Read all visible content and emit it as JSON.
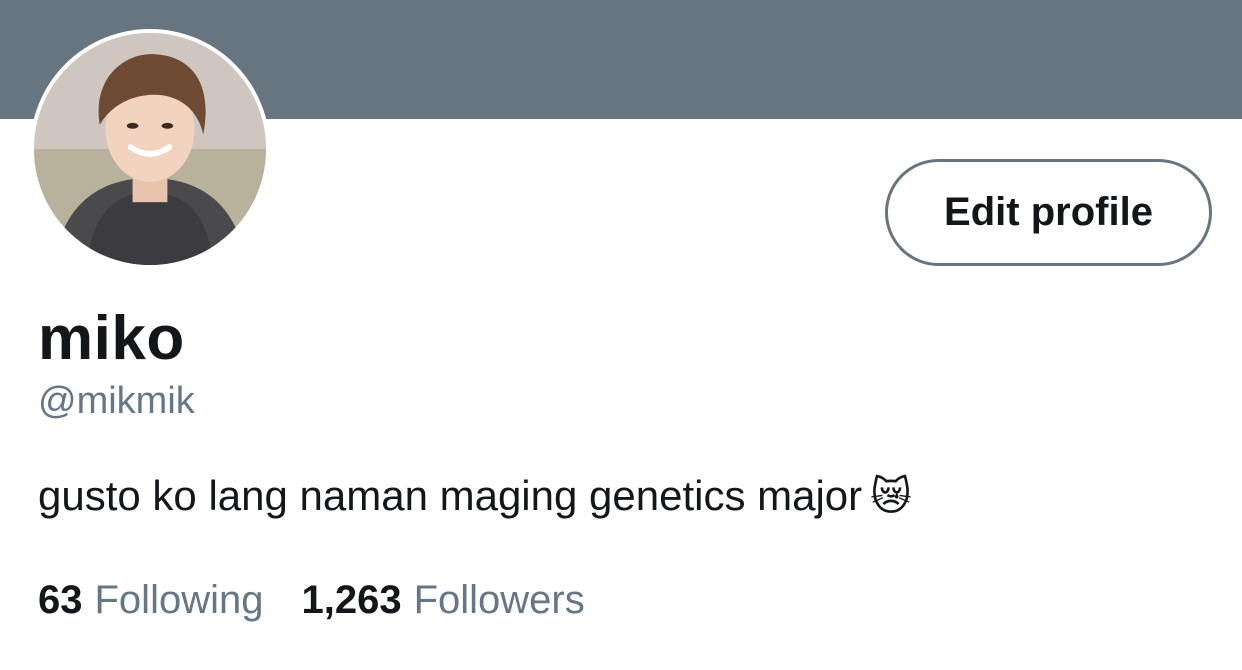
{
  "profile": {
    "display_name": "miko",
    "handle": "@mikmik",
    "bio": "gusto ko lang naman maging genetics major",
    "bio_emoji": "😿",
    "edit_button_label": "Edit profile"
  },
  "stats": {
    "following_count": "63",
    "following_label": "Following",
    "followers_count": "1,263",
    "followers_label": "Followers"
  },
  "colors": {
    "banner": "#66757f",
    "primary_text": "#14171a",
    "secondary_text": "#657786"
  }
}
